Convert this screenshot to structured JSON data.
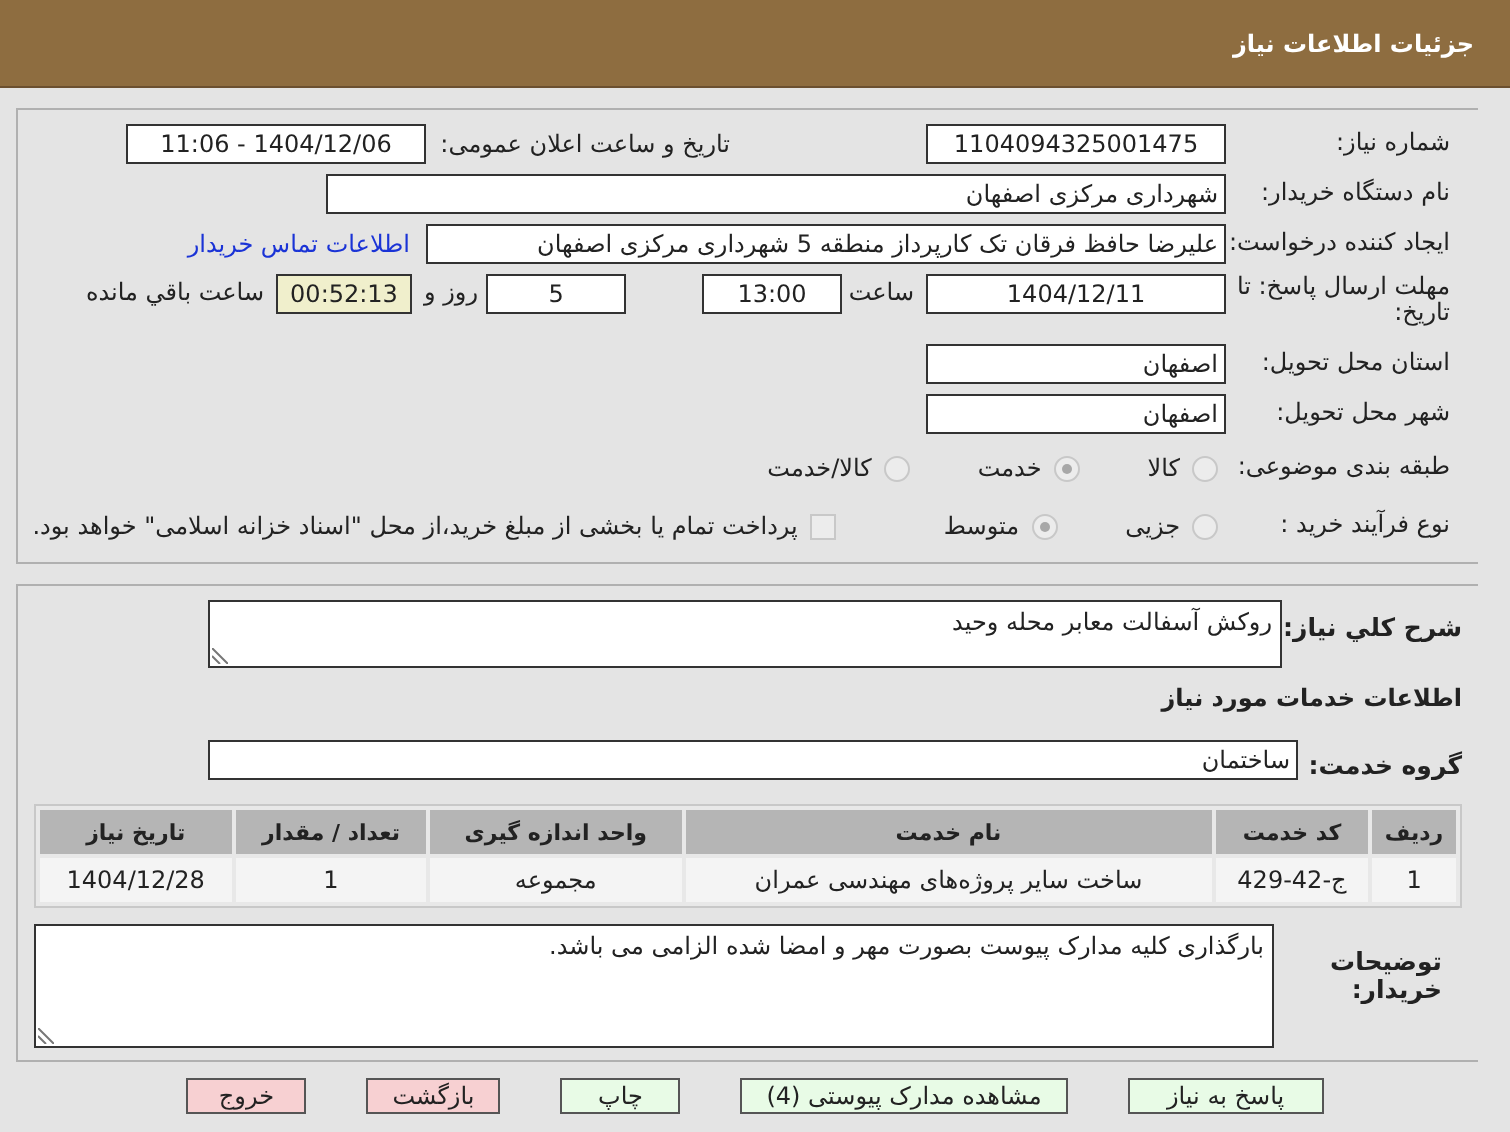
{
  "header": {
    "title": "جزئیات اطلاعات نیاز"
  },
  "details": {
    "need_number": {
      "label": "شماره نیاز:",
      "value": "1104094325001475"
    },
    "announce": {
      "label": "تاریخ و ساعت اعلان عمومی:",
      "value": "1404/12/06 - 11:06"
    },
    "buyer": {
      "label": "نام دستگاه خریدار:",
      "value": "شهرداری مرکزی اصفهان"
    },
    "creator": {
      "label": "ایجاد کننده درخواست:",
      "value": "علیرضا حافظ فرقان تک کارپرداز منطقه 5 شهرداری مرکزی اصفهان",
      "link": "اطلاعات تماس خریدار"
    },
    "deadline": {
      "label": "مهلت ارسال پاسخ: تا تاریخ:",
      "date": "1404/12/11",
      "time_label": "ساعت",
      "time": "13:00",
      "days": "5",
      "days_label": "روز و",
      "remaining": "00:52:13",
      "remaining_label": "ساعت باقي مانده"
    },
    "province": {
      "label": "استان محل تحویل:",
      "value": "اصفهان"
    },
    "city": {
      "label": "شهر محل تحویل:",
      "value": "اصفهان"
    },
    "category": {
      "label": "طبقه بندی موضوعی:",
      "options": [
        {
          "label": "کالا",
          "selected": false
        },
        {
          "label": "خدمت",
          "selected": true
        },
        {
          "label": "کالا/خدمت",
          "selected": false
        }
      ]
    },
    "process": {
      "label": "نوع فرآیند خرید :",
      "options": [
        {
          "label": "جزیی",
          "selected": false
        },
        {
          "label": "متوسط",
          "selected": true
        }
      ],
      "payment": {
        "label": "پرداخت تمام یا بخشی از مبلغ خرید،از محل \"اسناد خزانه اسلامی\" خواهد بود.",
        "checked": false
      }
    }
  },
  "services": {
    "description": {
      "label": "شرح کلي نياز:",
      "value": "روکش آسفالت معابر محله وحید"
    },
    "section_title": "اطلاعات خدمات مورد نیاز",
    "group": {
      "label": "گروه خدمت:",
      "value": "ساختمان"
    },
    "table": {
      "columns": [
        "ردیف",
        "کد خدمت",
        "نام خدمت",
        "واحد اندازه گیری",
        "تعداد / مقدار",
        "تاریخ نیاز"
      ],
      "rows": [
        [
          "1",
          "ج-42-429",
          "ساخت سایر پروژه‌های مهندسی عمران",
          "مجموعه",
          "1",
          "1404/12/28"
        ]
      ]
    },
    "notes": {
      "label": "توضیحات خریدار:",
      "value": "بارگذاری کلیه مدارک پیوست بصورت مهر و امضا شده الزامی می باشد."
    }
  },
  "buttons": [
    {
      "label": "پاسخ به نیاز",
      "kind": "normal"
    },
    {
      "label": "مشاهده مدارک پیوستی (4)",
      "kind": "normal"
    },
    {
      "label": "چاپ",
      "kind": "normal"
    },
    {
      "label": "بازگشت",
      "kind": "danger"
    },
    {
      "label": "خروج",
      "kind": "danger"
    }
  ]
}
